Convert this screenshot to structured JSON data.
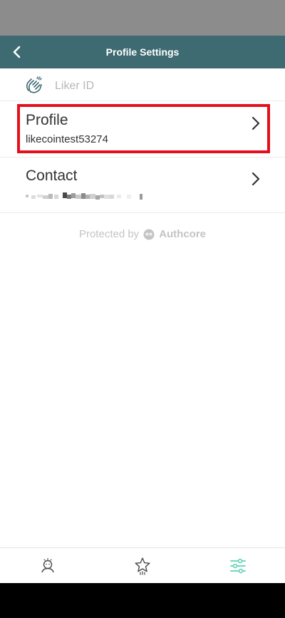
{
  "header": {
    "title": "Profile Settings",
    "back_icon": "chevron-left-icon"
  },
  "liker": {
    "label": "Liker ID",
    "icon": "clapping-hands-icon"
  },
  "profile": {
    "title": "Profile",
    "subtitle": "likecointest53274",
    "chevron": "chevron-right-icon"
  },
  "contact": {
    "title": "Contact",
    "subtitle_redacted": true,
    "chevron": "chevron-right-icon"
  },
  "footer": {
    "protected_by": "Protected by",
    "brand": "Authcore"
  },
  "tabs": [
    {
      "icon": "person-icon"
    },
    {
      "icon": "star-icon"
    },
    {
      "icon": "sliders-icon",
      "active": true
    }
  ],
  "colors": {
    "app_bar": "#3e6a71",
    "highlight": "#e3101b",
    "active_tab": "#5fd3b3",
    "inactive_tab": "#4a4a4a"
  }
}
